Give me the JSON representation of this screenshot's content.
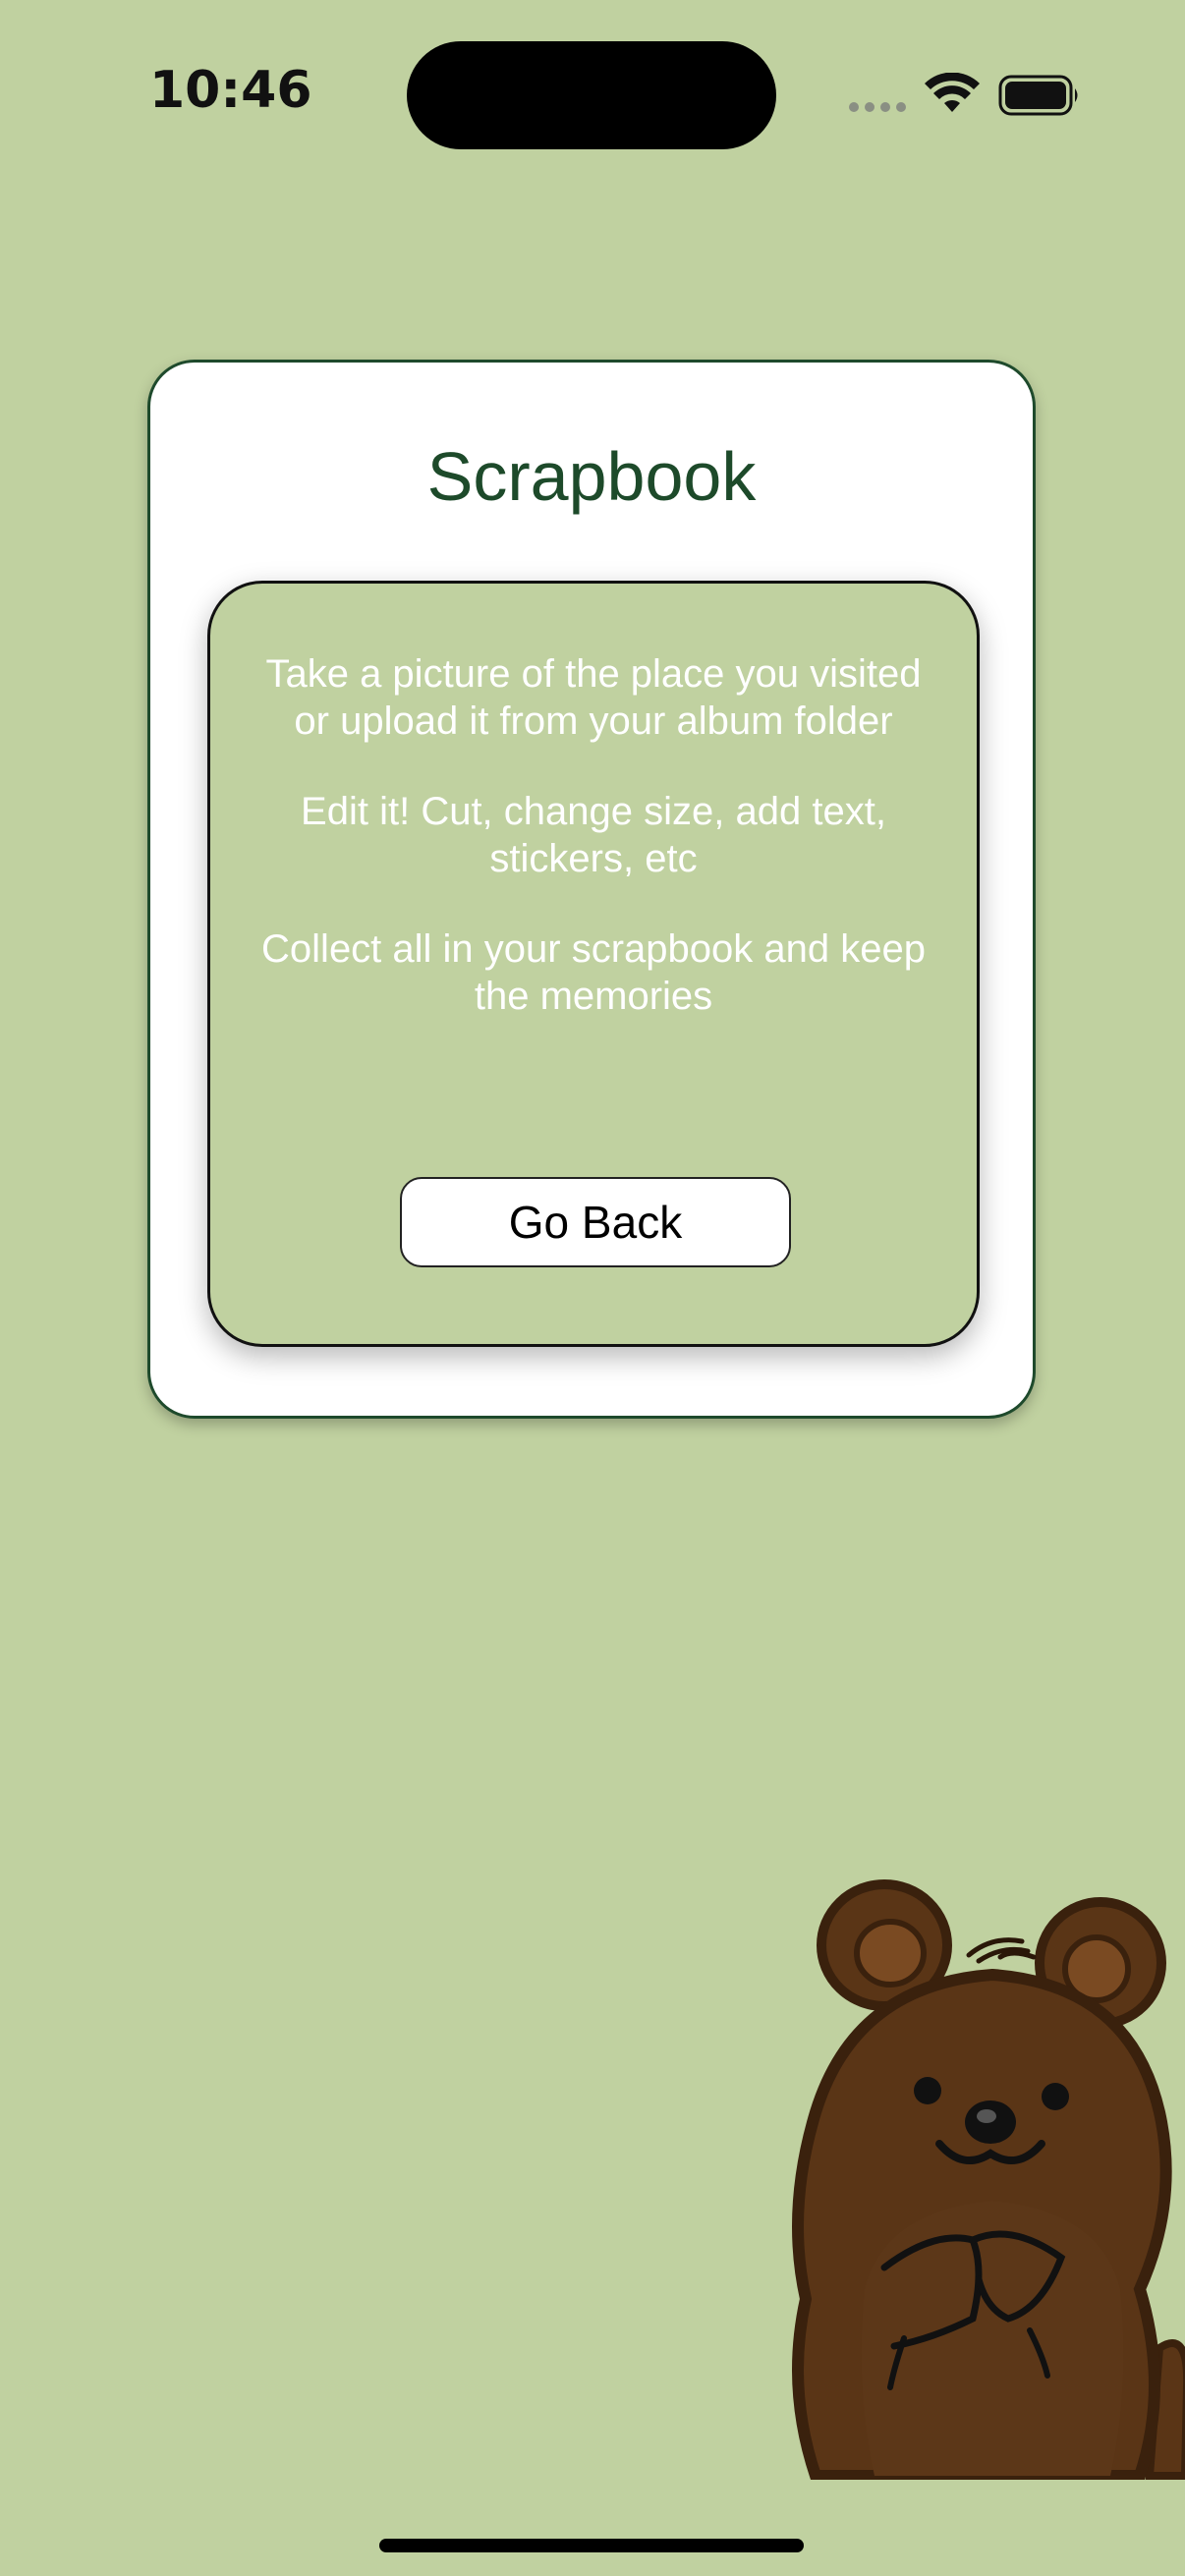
{
  "status_bar": {
    "time": "10:46",
    "icons": [
      "cellular-signal-icon",
      "wifi-icon",
      "battery-icon"
    ]
  },
  "card": {
    "title": "Scrapbook",
    "instructions": [
      "Take a picture of the place you visited or upload it from your album folder",
      "Edit it! Cut, change size, add text, stickers, etc",
      "Collect all in your scrapbook and keep the memories"
    ],
    "go_back_label": "Go Back"
  },
  "illustration": {
    "name": "quokka-illustration"
  },
  "colors": {
    "background": "#c0d1a0",
    "title": "#1d4a2a",
    "card": "#ffffff",
    "bear_body": "#5a3516",
    "bear_outline": "#3a210d"
  }
}
